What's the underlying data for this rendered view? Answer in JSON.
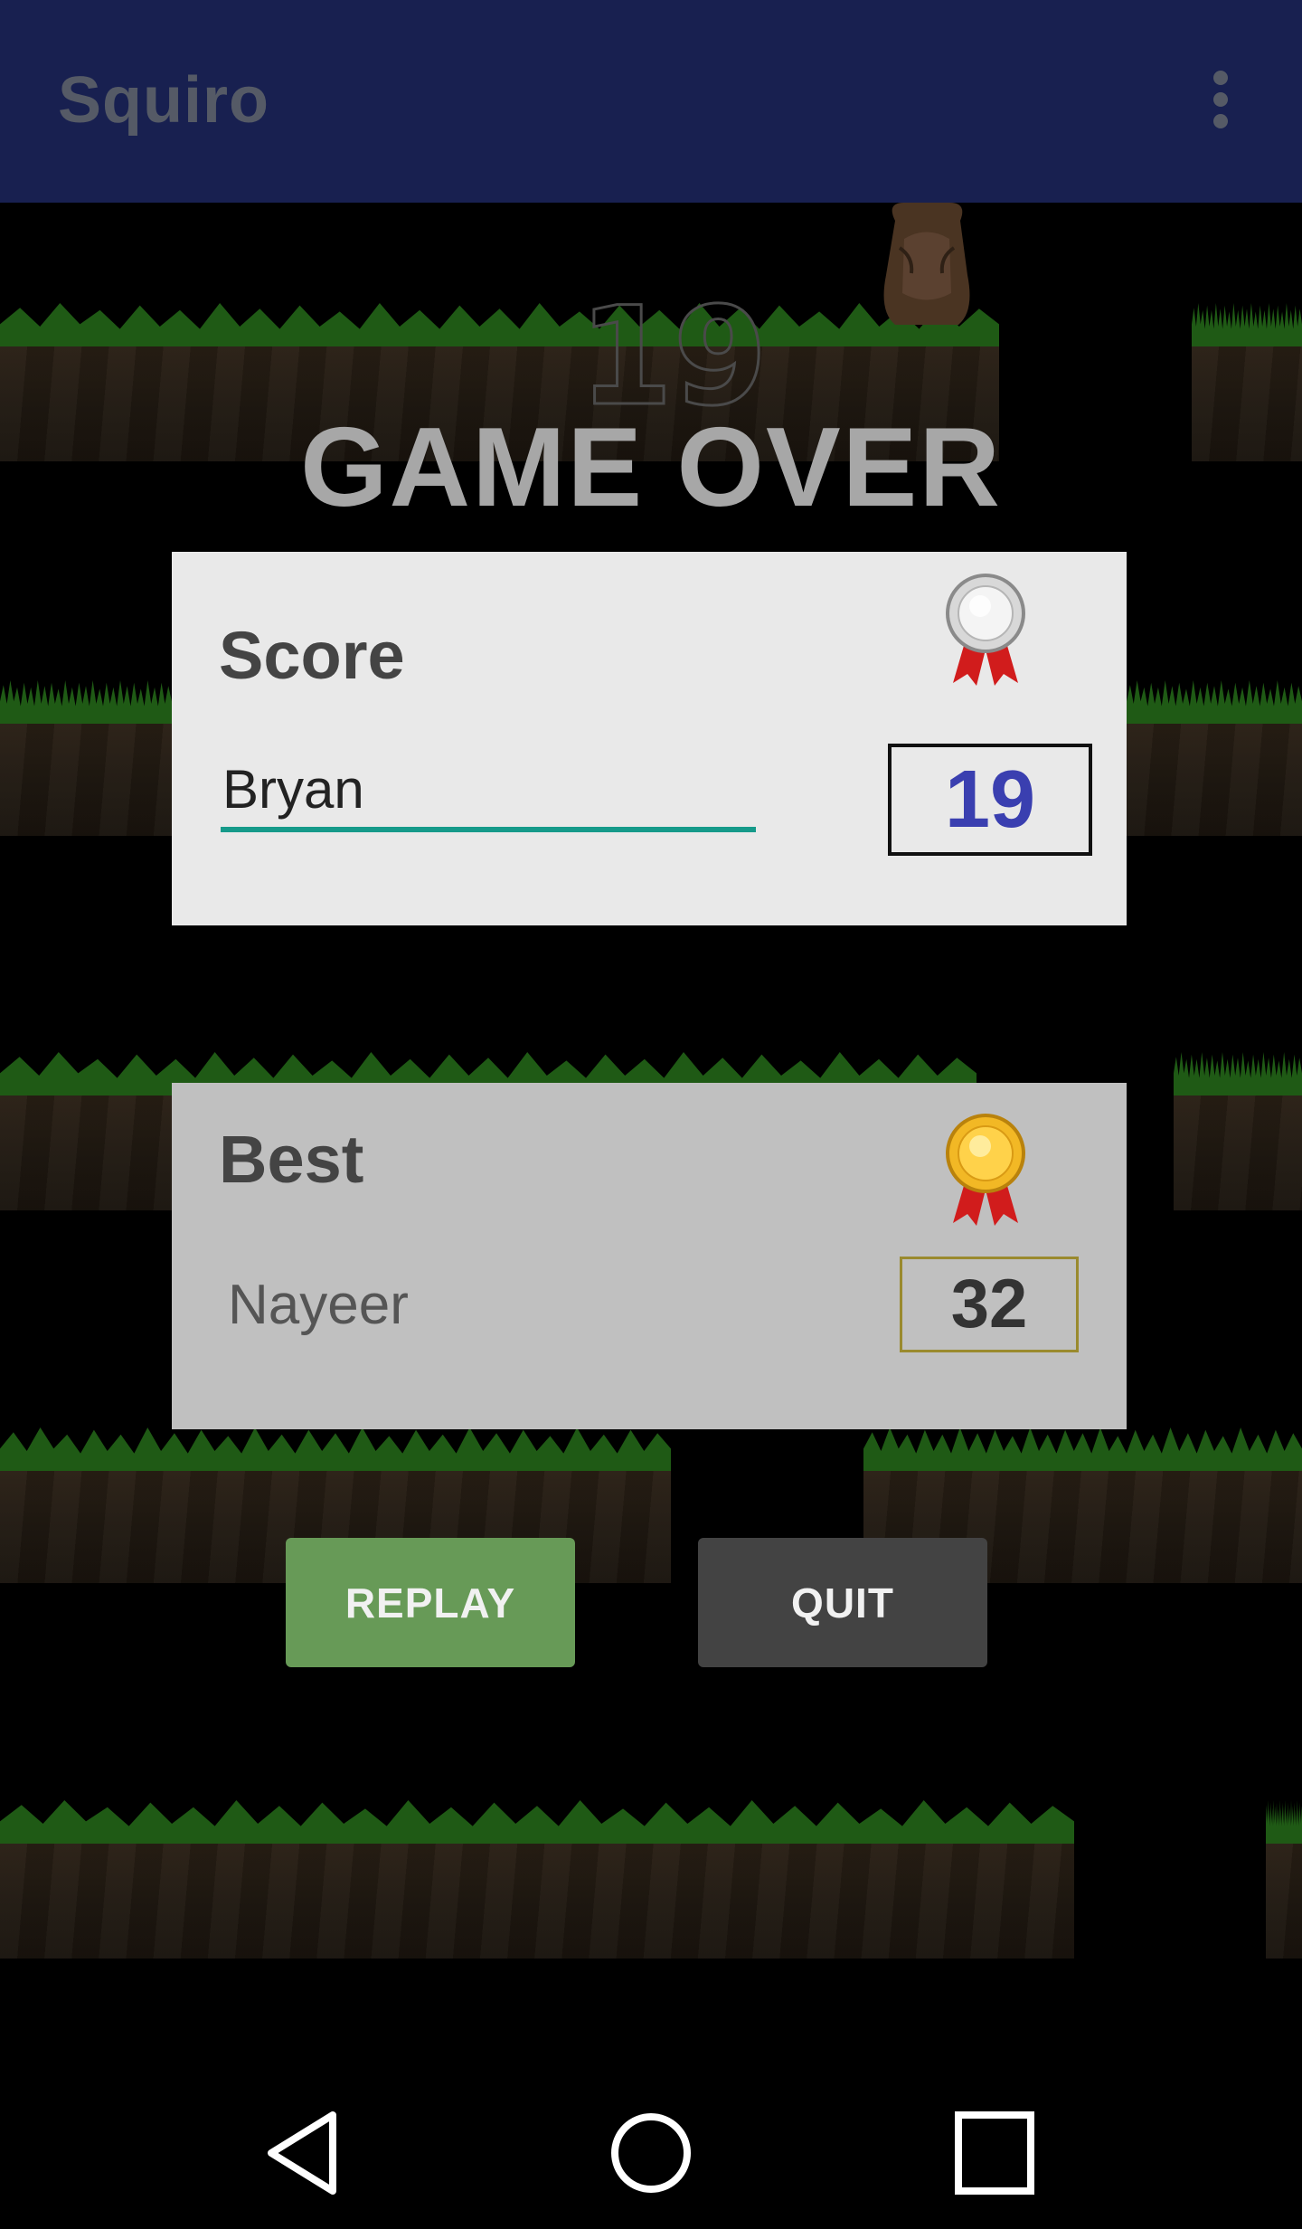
{
  "app_bar": {
    "title": "Squiro",
    "overflow_icon": "overflow-menu-icon"
  },
  "game": {
    "background_score": "19",
    "heading": "GAME OVER",
    "player_sprite": "squirrel-icon"
  },
  "score_panel": {
    "title": "Score",
    "medal": "silver-medal-icon",
    "player_name_value": "Bryan",
    "score": "19",
    "score_color": "#3a3fb0",
    "underline_color": "#169a8a"
  },
  "best_panel": {
    "title": "Best",
    "medal": "gold-medal-icon",
    "player_name": "Nayeer",
    "score": "32"
  },
  "buttons": {
    "replay_label": "REPLAY",
    "replay_color": "#679a57",
    "quit_label": "QUIT",
    "quit_color": "#434343"
  },
  "nav_bar": {
    "back_icon": "back-icon",
    "home_icon": "home-icon",
    "recents_icon": "recents-icon"
  }
}
